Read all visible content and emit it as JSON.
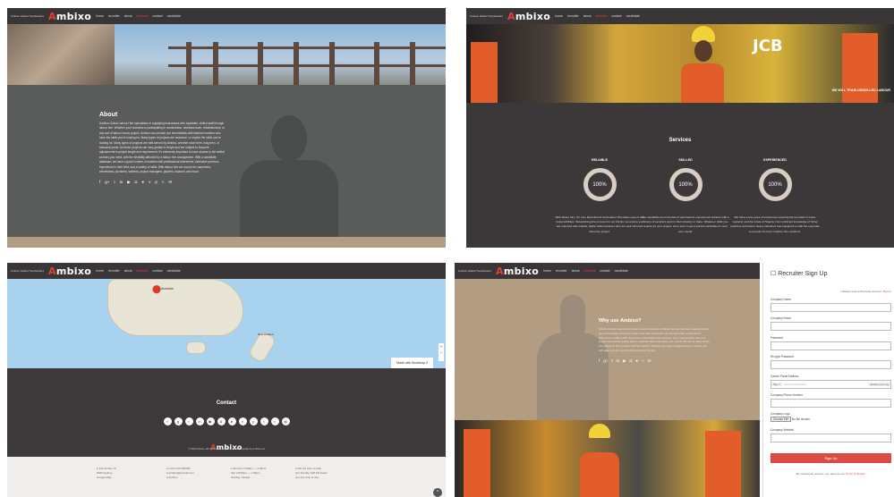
{
  "brand": {
    "tagline": "Ambixo Global Trendsetters",
    "logo_prefix": "A",
    "logo_rest": "mbixo",
    "accent": "#e0403a"
  },
  "nav": {
    "items": [
      "home",
      "recruiter",
      "about",
      "services",
      "contact",
      "candidate"
    ],
    "active_index": 3
  },
  "about": {
    "title": "About",
    "body": "Ambixo Global Labour Hire specialises in supplying businesses with reputable, skilled staff through labour hire. Whether your business is participating in construction, electrical work, refurbishment, or any sort of labour heavy project, Ambixo can provide you immediately with talented workers who have the skills you're looking for. Many types of projects are seasonal, or require the skills you're looking for. Many types of projects are well-served by Ambixo, whether short term, long term, or seasonal posts. As these projects can vary greatly in length and are subject to frequent adjustments in project length and requirement, it's extremely important to have access to the skilled workers you need, with the flexibility afforded by a labour hire arrangement. With a candidate database, we have a good number of workers with professional references, extensive previous experience in their field, and a variety of skills. With labour hire we source for carpenters, electricians, plumbers, welders, project managers, glaziers, masons, and more."
  },
  "hero2_caption": "WE WILL TRAIN UNSKILLED LABOUR",
  "services": {
    "title": "Services",
    "items": [
      {
        "title": "RELIABLE",
        "value": "100%",
        "text": "With labour hire, On Line Recruitment and Labour Hire takes care of our responsibilities. Streamlining the process for our clients, we ensure you are matched with reliable, highly skilled workers who are well informed about the project."
      },
      {
        "title": "SKILLED",
        "value": "100%",
        "text": "Our candidate pool consists of well-trained, experienced workers with a history of excellent work in their industry or trade. Whatever skills you require for your project, we're sure to get a perfect candidate to meet your needs."
      },
      {
        "title": "EXPERIENCED",
        "value": "100%",
        "text": "We have a few years of experience securing the top talent in local, regional, and the whole of Nigeria. Our combined knowledge of hiring practices and labour heavy industries has equipped us with the expertise to provide the best in labour hire solutions."
      }
    ]
  },
  "map": {
    "pin_label": "Australia",
    "button": "Made with Bootstrap 3",
    "region_label": "New Zealand"
  },
  "contact": {
    "title": "Contact",
    "copyright": "© 2015 Ambixo. All rights reserved. ABN 12345 Template by Ambixo Ltd",
    "footer": [
      {
        "lines": [
          "123 Ambixo St",
          "2000 Sydney",
          "Google Map"
        ]
      },
      {
        "lines": [
          "(+61) 123-456789",
          "ambixo@upmail.com",
          "Ambixo"
        ]
      },
      {
        "lines": [
          "Mon-Fri: 9:00am — 5:00pm",
          "Sat: 10:00am — 1:30pm",
          "Sunday: Closed"
        ]
      },
      {
        "lines": [
          "We are here to help",
          "Our friendly staff will assist",
          "you any time of day"
        ]
      }
    ]
  },
  "why": {
    "title": "Why use Ambixo?",
    "body": "Ambixo Global Labour Hire knows about the process of labour hire and has been helping clients hire and manage workers for years. Our team works with you through initial contact to the placement of skilled staff. We work to understand your business, your requirements, and your project. We provide quality labour, available when and where you need it. We aim to make labour hire simple for the company and the workers. Whether you need a single worker or a team, we will make sure you get the right people for the job."
  },
  "signup": {
    "title": "Recruiter Sign Up",
    "already": "I already have a Recruiter Account.",
    "signin": "Sign In",
    "fields": [
      "Company Name",
      "Company Email",
      "Password",
      "Re-type Password"
    ],
    "portal_label": "Career Portal Address",
    "portal_prefix": "http://",
    "portal_placeholder": "yourcompanyname",
    "portal_suffix": ".ambixo.com.ng",
    "phone_label": "Company Phone Number",
    "logo_label": "Company Logo",
    "file_button": "Choose File",
    "file_status": "No file chosen",
    "website_label": "Company Website",
    "button": "Sign Up",
    "terms_prefix": "By creating an account, you agree to our",
    "terms_link": "Terms of Service"
  }
}
